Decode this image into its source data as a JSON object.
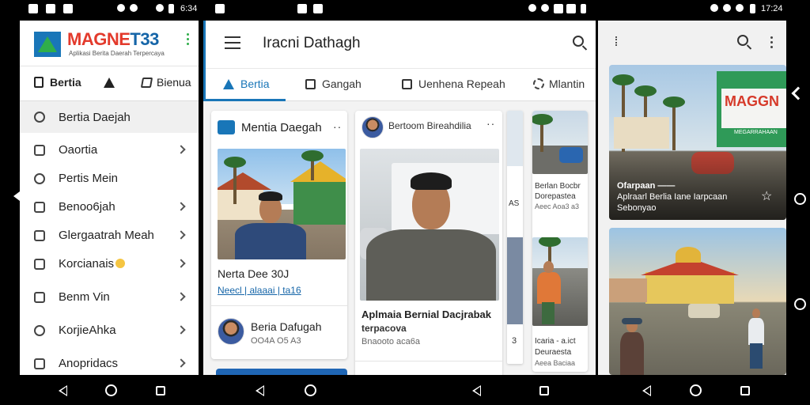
{
  "status_bar": {
    "left_time": "6:34",
    "right_time": "17:24"
  },
  "panel1": {
    "logo": {
      "text_a": "MAGNE",
      "text_b": "T33",
      "subtitle": "Aplikasi Berita Daerah Terpercaya"
    },
    "tabs": [
      {
        "label": "Bertia",
        "icon": "bag-icon"
      },
      {
        "label": "",
        "icon": "alert-icon"
      },
      {
        "label": "Bienua",
        "icon": "edit-icon"
      }
    ],
    "selected_item": {
      "label": "Bertia Daejah",
      "icon": "clock-icon"
    },
    "menu_items": [
      {
        "label": "Oaortia",
        "icon": "grid-icon",
        "chevron": true
      },
      {
        "label": "Pertis Mein",
        "icon": "refresh-icon",
        "chevron": false
      },
      {
        "label": "Benoo6jah",
        "icon": "building-icon",
        "chevron": true
      },
      {
        "label": "Glergaatrah Meah",
        "icon": "chat-icon",
        "chevron": true
      },
      {
        "label": "Korcianais",
        "icon": "calendar-icon",
        "chevron": true
      },
      {
        "label": "Benm Vin",
        "icon": "list-icon",
        "chevron": true
      },
      {
        "label": "KorjieAhka",
        "icon": "people-icon",
        "chevron": true
      },
      {
        "label": "Anopridacs",
        "icon": "home-icon",
        "chevron": true
      }
    ]
  },
  "panel2": {
    "title": "Iracni Dathagh",
    "tabs": [
      {
        "label": "Bertia",
        "icon": "triangle-icon",
        "active": true
      },
      {
        "label": "Gangah",
        "icon": "check-icon",
        "active": false
      },
      {
        "label": "Uenhena Repeah",
        "icon": "edit-icon",
        "active": false
      },
      {
        "label": "Mlantin",
        "icon": "gear-icon",
        "active": false
      }
    ],
    "card1": {
      "header": "Mentia Daegah",
      "title": "Nerta Dee 30J",
      "link": "Neecl | alaaai | ta16",
      "footer_name": "Beria Dafugah",
      "footer_meta": "OO4A O5 A3"
    },
    "card2": {
      "header": "Bertoom Bireahdilia",
      "title": "Aplmaia Bernial Dacjrabak",
      "subtitle": "terpacova",
      "meta": "Bnaooto aca6a"
    },
    "card3": {
      "top_text": [
        "Berlan Bocbr",
        "Dorepastea",
        "Aeec Aoa3 a3"
      ],
      "bottom_text": [
        "Icaria - a.ict",
        "Deuraesta",
        "Aeea Baciaa"
      ]
    },
    "strip_labels": [
      "AS",
      "3"
    ]
  },
  "panel3": {
    "card1_caption": [
      "Ofarpaan ——",
      "Aplraarl Berlia Iane Iarpcaan",
      "Sebonyao"
    ],
    "sign_text": "MAGGN",
    "sign_sub": "MEGARRAHAAN"
  },
  "colors": {
    "accent": "#1976b8",
    "logo_red": "#e33a2c",
    "logo_green": "#2fae4a"
  }
}
